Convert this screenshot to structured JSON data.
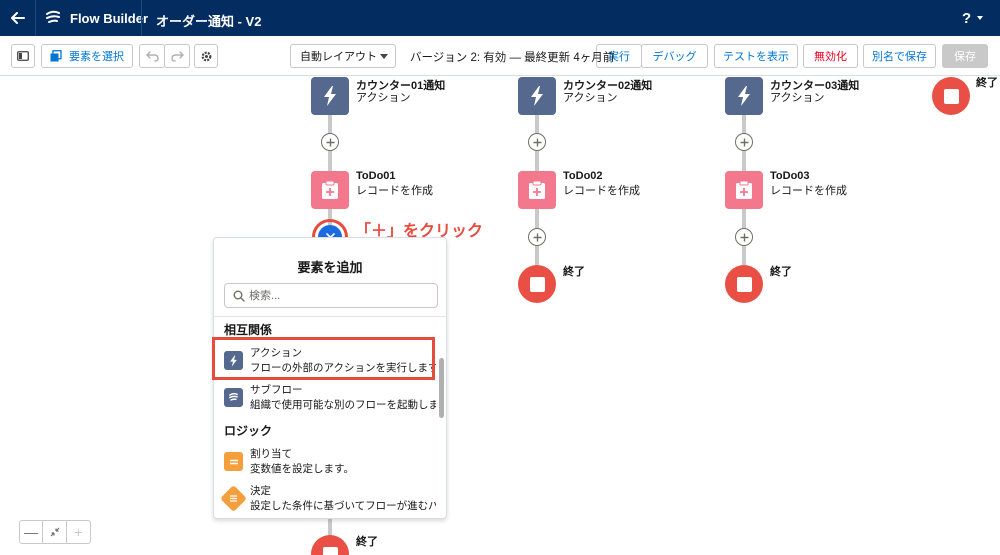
{
  "header": {
    "app_name": "Flow Builder",
    "flow_name": "オーダー通知 - V2",
    "help": "?"
  },
  "toolbar": {
    "select_elements": "要素を選択",
    "layout_select": "自動レイアウト",
    "version_status": "バージョン 2: 有効 — 最終更新 4ヶ月前",
    "run": "実行",
    "debug": "デバッグ",
    "view_tests": "テストを表示",
    "deactivate": "無効化",
    "save_as": "別名で保存",
    "save": "保存"
  },
  "canvas": {
    "columns": [
      {
        "action_title": "カウンター01通知",
        "action_sub": "アクション",
        "record_title": "ToDo01",
        "record_sub": "レコードを作成"
      },
      {
        "action_title": "カウンター02通知",
        "action_sub": "アクション",
        "record_title": "ToDo02",
        "record_sub": "レコードを作成",
        "end_label": "終了"
      },
      {
        "action_title": "カウンター03通知",
        "action_sub": "アクション",
        "record_title": "ToDo03",
        "record_sub": "レコードを作成",
        "end_label": "終了"
      }
    ],
    "far_right_end_label": "終了",
    "bottom_end_label": "終了"
  },
  "annotation": {
    "text": "「＋」をクリック",
    "color": "#e84b3c"
  },
  "popover": {
    "title": "要素を追加",
    "search_placeholder": "検索...",
    "sections": [
      {
        "title": "相互関係",
        "items": [
          {
            "name": "アクション",
            "desc": "フローの外部のアクションを実行します...",
            "icon": "bolt-icon",
            "color": "#54698d"
          },
          {
            "name": "サブフロー",
            "desc": "組織で使用可能な別のフローを起動しま...",
            "icon": "subflow-icon",
            "color": "#54698d"
          }
        ]
      },
      {
        "title": "ロジック",
        "items": [
          {
            "name": "割り当て",
            "desc": "変数値を設定します。",
            "icon": "assignment-icon",
            "color": "#f49f3c"
          },
          {
            "name": "決定",
            "desc": "設定した条件に基づいてフローが進むパ...",
            "icon": "decision-icon",
            "color": "#f49f3c"
          }
        ]
      }
    ]
  },
  "zoom": {
    "minus": "—",
    "plus": "+"
  },
  "colors": {
    "header_bg": "#032d60",
    "action_node": "#54698d",
    "record_node": "#f3788e",
    "end_node": "#ea4f45",
    "brand_blue": "#0176d3"
  }
}
